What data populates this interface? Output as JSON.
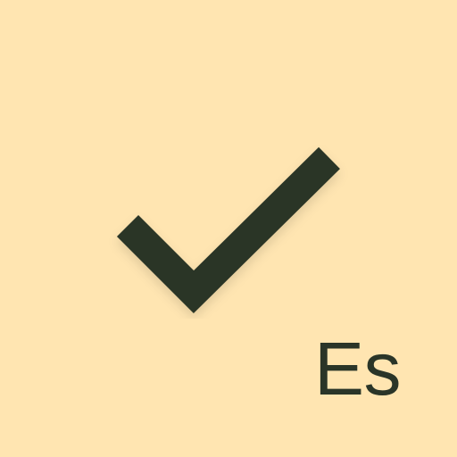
{
  "icon": {
    "name": "check-icon",
    "color": "#2a3528"
  },
  "language": {
    "code": "Es"
  },
  "colors": {
    "background": "#ffe5b1",
    "foreground": "#2a3528"
  }
}
